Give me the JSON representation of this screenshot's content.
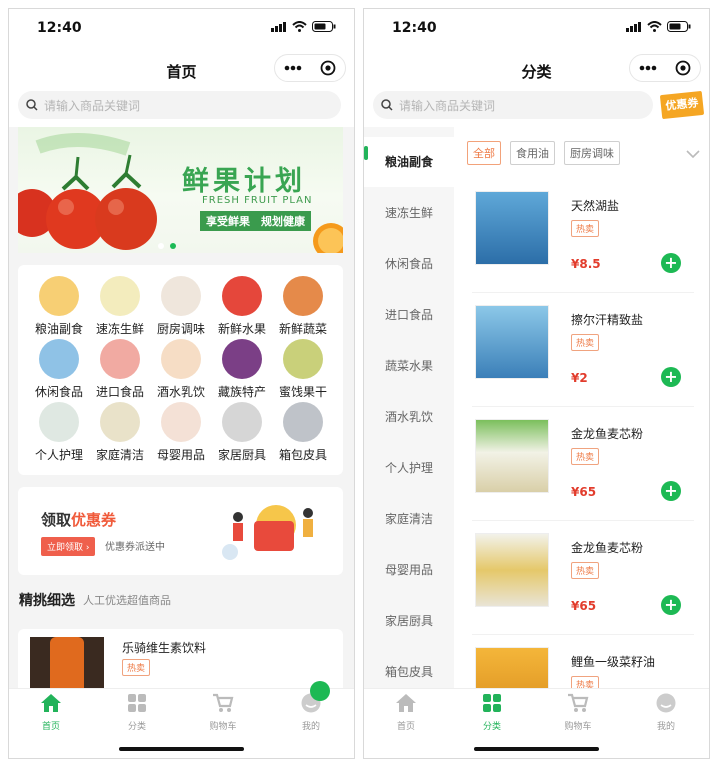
{
  "left": {
    "time": "12:40",
    "title": "首页",
    "search_placeholder": "请输入商品关键词",
    "banner": {
      "title": "鲜果计划",
      "subtitle": "FRESH FRUIT PLAN",
      "slogan": "享受鲜果　规划健康"
    },
    "categories": [
      "粮油副食",
      "速冻生鲜",
      "厨房调味",
      "新鲜水果",
      "新鲜蔬菜",
      "休闲食品",
      "进口食品",
      "酒水乳饮",
      "藏族特产",
      "蜜饯果干",
      "个人护理",
      "家庭清洁",
      "母婴用品",
      "家居厨具",
      "箱包皮具"
    ],
    "coupon": {
      "prefix": "领取",
      "highlight": "优惠券",
      "button": "立即领取 ›",
      "sub": "优惠券派送中"
    },
    "section": {
      "title": "精挑细选",
      "sub": "人工优选超值商品"
    },
    "product": {
      "name": "乐骑维生素饮料",
      "tag": "热卖"
    }
  },
  "right": {
    "time": "12:40",
    "title": "分类",
    "search_placeholder": "请输入商品关键词",
    "coupon_tag": "优惠券",
    "sidebar": [
      "粮油副食",
      "速冻生鲜",
      "休闲食品",
      "进口食品",
      "蔬菜水果",
      "酒水乳饮",
      "个人护理",
      "家庭清洁",
      "母婴用品",
      "家居厨具",
      "箱包皮具"
    ],
    "sidebar_active": 0,
    "chips": [
      "全部",
      "食用油",
      "厨房调味"
    ],
    "products": [
      {
        "name": "天然湖盐",
        "tag": "热卖",
        "price": "¥8.5"
      },
      {
        "name": "擦尔汗精致盐",
        "tag": "热卖",
        "price": "¥2"
      },
      {
        "name": "金龙鱼麦芯粉",
        "tag": "热卖",
        "price": "¥65"
      },
      {
        "name": "金龙鱼麦芯粉",
        "tag": "热卖",
        "price": "¥65"
      },
      {
        "name": "鲤鱼一级菜籽油",
        "tag": "热卖",
        "price": ""
      }
    ]
  },
  "tabs": [
    "首页",
    "分类",
    "购物车",
    "我的"
  ],
  "colors": {
    "accent": "#22b35a",
    "price": "#e23c2c",
    "tag": "#ee7b47"
  }
}
